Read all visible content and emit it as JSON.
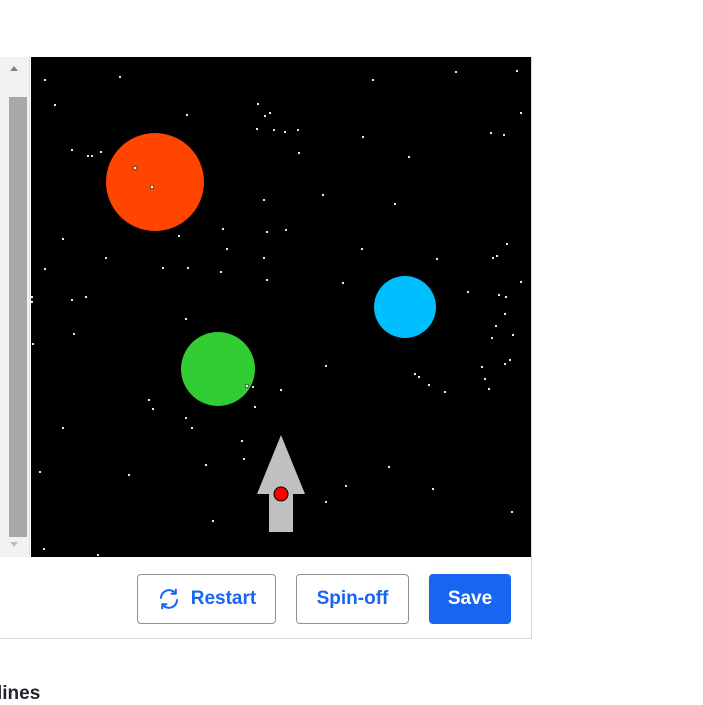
{
  "buttons": {
    "restart_label": "Restart",
    "restart_icon": "restart-icon",
    "spinoff_label": "Spin-off",
    "save_label": "Save"
  },
  "section": {
    "title": "lines"
  },
  "colors": {
    "canvas_background": "#000000",
    "planet_orange": "#ff4500",
    "planet_blue": "#00bfff",
    "planet_green": "#32cd32",
    "rocket_body": "#c0c0c0",
    "rocket_window": "#ff0000",
    "accent_blue": "#1865f2"
  }
}
